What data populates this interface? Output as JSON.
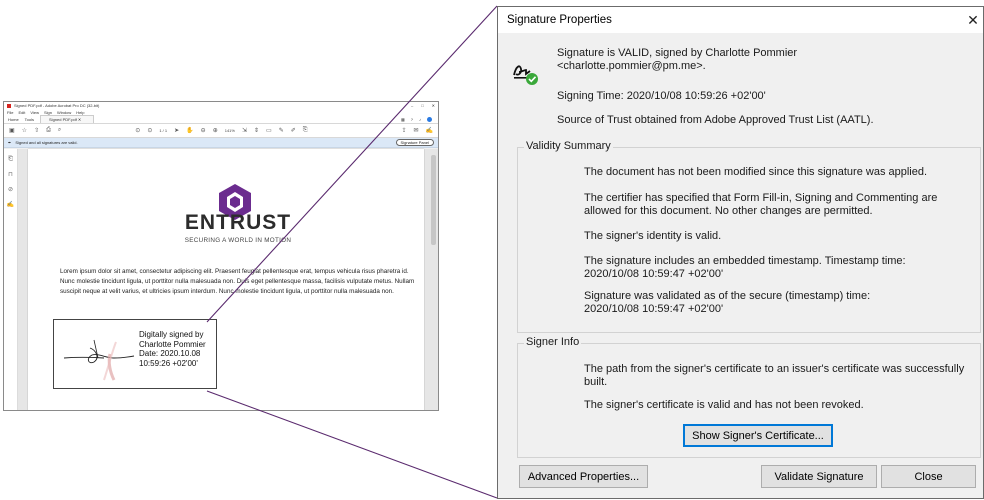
{
  "acrobat": {
    "window_title": "Signed PDF.pdf - Adobe Acrobat Pro DC (32-bit)",
    "menu": [
      "File",
      "Edit",
      "View",
      "Sign",
      "Window",
      "Help"
    ],
    "tabs": [
      "Home",
      "Tools"
    ],
    "doc_tab": "Signed PDF.pdf",
    "page_indicator": "1 / 1",
    "zoom": "141%",
    "signature_bar_text": "Signed and all signatures are valid.",
    "signature_panel_button": "Signature Panel",
    "page": {
      "brand": "ENTRUST",
      "tagline": "SECURING A WORLD IN MOTION",
      "body_text": "Lorem ipsum dolor sit amet, consectetur adipiscing elit. Praesent feugiat pellentesque erat, tempus vehicula risus pharetra id. Nunc molestie tincidunt ligula, ut porttitor nulla malesuada non. Duis eget pellentesque massa, facilisis vulputate metus. Nullam suscipit neque at velit varius, et ultricies ipsum interdum. Nunc molestie tincidunt ligula, ut porttitor nulla malesuada non.",
      "signature_lines": [
        "Digitally signed by",
        "Charlotte Pommier",
        "Date: 2020.10.08",
        "10:59:26 +02'00'"
      ]
    },
    "colors": {
      "brand_purple": "#6b2c8f",
      "signature_bar": "#dbe8f7"
    }
  },
  "dialog": {
    "title": "Signature Properties",
    "close_glyph": "✕",
    "status_line1": "Signature is VALID, signed by Charlotte Pommier",
    "status_line2": "<charlotte.pommier@pm.me>.",
    "signing_time": "Signing Time:  2020/10/08 10:59:26 +02'00'",
    "trust_source": "Source of Trust obtained from Adobe Approved Trust List (AATL).",
    "validity_summary": {
      "legend": "Validity Summary",
      "items": [
        "The document has not been modified since this signature was applied.",
        "The certifier has specified that Form Fill-in, Signing and Commenting are allowed for this document. No other changes are permitted.",
        "The signer's identity is valid.",
        "The signature includes an embedded timestamp. Timestamp time: 2020/10/08 10:59:47 +02'00'",
        "Signature was validated as of the secure (timestamp) time: 2020/10/08 10:59:47 +02'00'"
      ]
    },
    "signer_info": {
      "legend": "Signer Info",
      "items": [
        "The path from the signer's certificate to an issuer's certificate was successfully built.",
        "The signer's certificate is valid and has not been revoked."
      ],
      "show_certificate_button": "Show Signer's Certificate..."
    },
    "buttons": {
      "advanced": "Advanced Properties...",
      "validate": "Validate Signature",
      "close": "Close"
    },
    "colors": {
      "valid_green": "#3aa83a",
      "focus_blue": "#0078d7",
      "callout_line": "#5a2a6e"
    }
  }
}
